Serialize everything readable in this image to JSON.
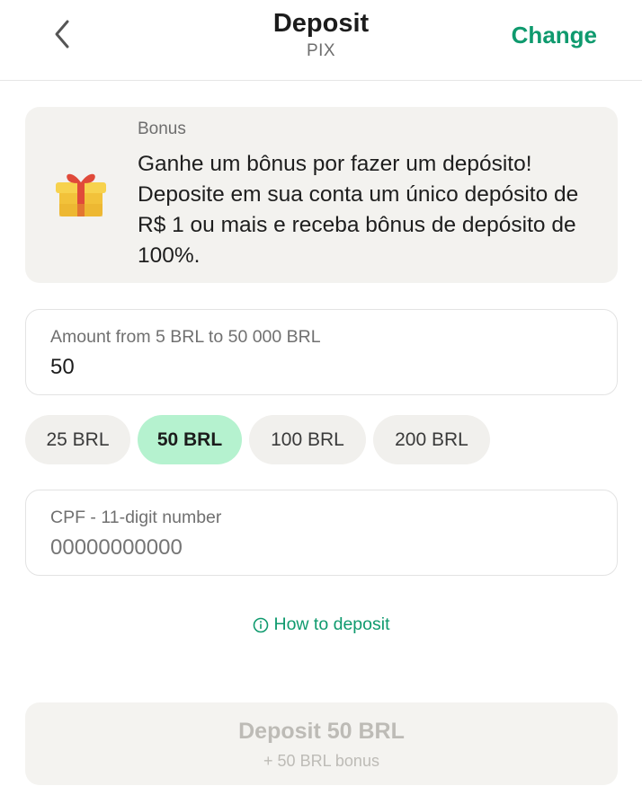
{
  "header": {
    "title": "Deposit",
    "subtitle": "PIX",
    "change_label": "Change",
    "back_icon": "chevron-left-icon"
  },
  "bonus": {
    "label": "Bonus",
    "text": "Ganhe um bônus por fazer um depósito! Deposite em sua conta um único depósito de R$ 1 ou mais e receba bônus de depósito de 100%.",
    "icon": "gift-icon"
  },
  "amount": {
    "label": "Amount from 5 BRL to 50 000 BRL",
    "value": "50"
  },
  "presets": [
    {
      "label": "25 BRL",
      "selected": false
    },
    {
      "label": "50 BRL",
      "selected": true
    },
    {
      "label": "100 BRL",
      "selected": false
    },
    {
      "label": "200 BRL",
      "selected": false
    }
  ],
  "cpf": {
    "label": "CPF - 11-digit number",
    "placeholder": "00000000000"
  },
  "howto": {
    "label": "How to deposit",
    "icon": "info-icon"
  },
  "deposit_button": {
    "label": "Deposit 50 BRL",
    "sublabel": "+ 50 BRL bonus"
  },
  "colors": {
    "accent": "#0f9a6e",
    "selected_chip": "#b5f2cf",
    "card_bg": "#f3f2ef"
  }
}
